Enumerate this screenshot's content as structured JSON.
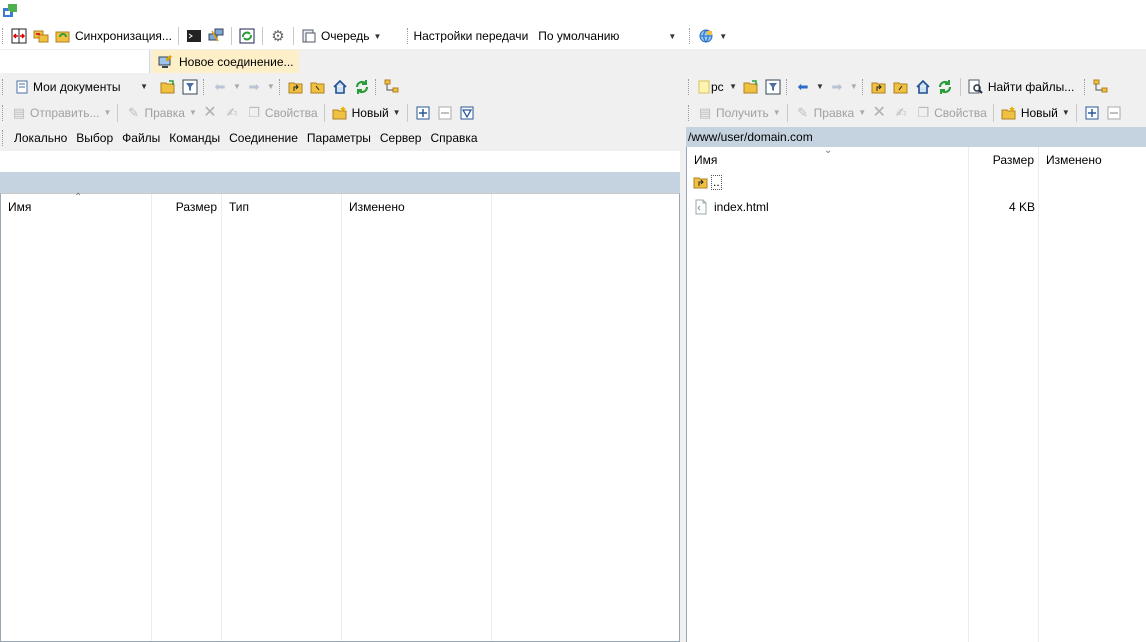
{
  "toolbar_main": {
    "sync_label": "Синхронизация...",
    "queue_label": "Очередь",
    "transfer_settings_label": "Настройки передачи",
    "transfer_preset": "По умолчанию",
    "new_session_label": "Новое соединение..."
  },
  "local": {
    "location": "Мои документы",
    "toolbar": {
      "send": "Отправить...",
      "edit": "Правка",
      "properties": "Свойства",
      "new": "Новый"
    },
    "menu": [
      "Локально",
      "Выбор",
      "Файлы",
      "Команды",
      "Соединение",
      "Параметры",
      "Сервер",
      "Справка"
    ],
    "path": "",
    "columns": [
      "Имя",
      "Размер",
      "Тип",
      "Изменено"
    ]
  },
  "remote": {
    "location": "pc",
    "find_files": "Найти файлы...",
    "toolbar": {
      "download": "Получить",
      "edit": "Правка",
      "properties": "Свойства",
      "new": "Новый"
    },
    "path": "/www/user/domain.com",
    "columns": [
      "Имя",
      "Размер",
      "Изменено"
    ],
    "files": [
      {
        "name": "..",
        "size": "",
        "modified": "",
        "type": "parent"
      },
      {
        "name": "index.html",
        "size": "4 KB",
        "modified": "",
        "type": "file"
      }
    ]
  }
}
